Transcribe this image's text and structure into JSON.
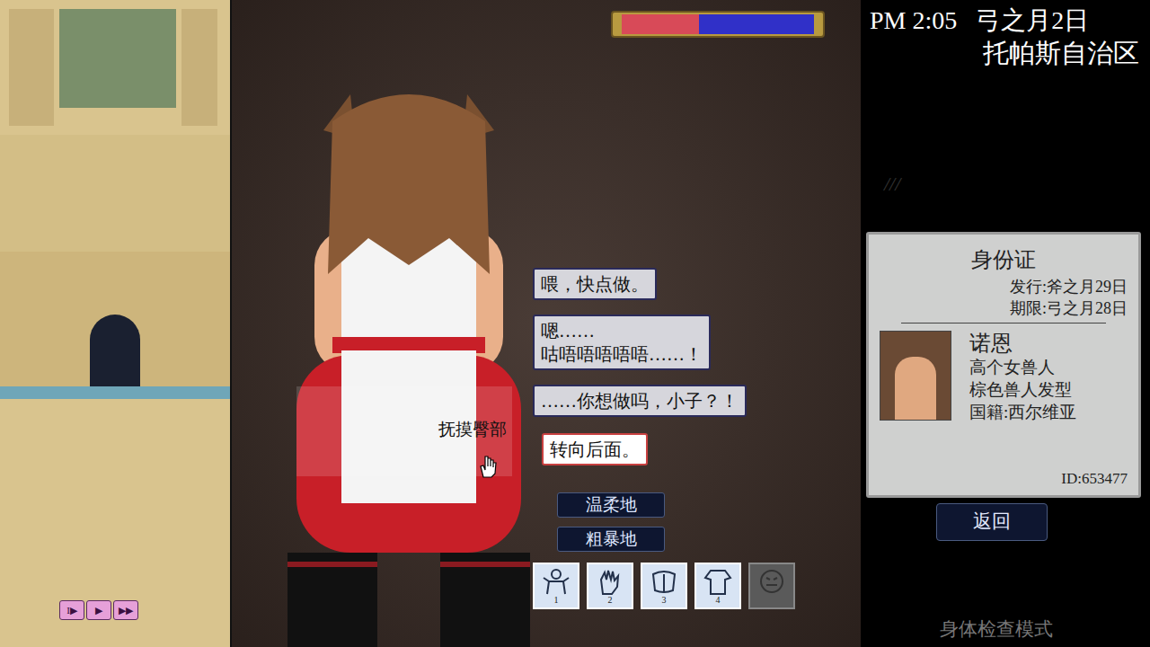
{
  "clock": {
    "time": "PM 2:05",
    "date": "弓之月2日",
    "location": "托帕斯自治区"
  },
  "scratch": "///",
  "gauge": {
    "level": 0.4
  },
  "dialog": [
    {
      "text": "喂，快点做。",
      "speaker": "npc"
    },
    {
      "text": "嗯……\n咕唔唔唔唔唔……！",
      "speaker": "npc"
    },
    {
      "text": "……你想做吗，小子？！",
      "speaker": "npc"
    },
    {
      "text": "转向后面。",
      "speaker": "player"
    }
  ],
  "hover_label": "抚摸臀部",
  "choices": [
    "温柔地",
    "粗暴地"
  ],
  "toolbar": [
    {
      "number": "1",
      "disabled": false
    },
    {
      "number": "2",
      "disabled": false
    },
    {
      "number": "3",
      "disabled": false
    },
    {
      "number": "4",
      "disabled": false
    },
    {
      "number": "",
      "disabled": true
    }
  ],
  "id_card": {
    "title": "身份证",
    "issued": "发行:斧之月29日",
    "expires": "期限:弓之月28日",
    "name": "诺恩",
    "lines": [
      "高个女兽人",
      "棕色兽人发型",
      "国籍:西尔维亚"
    ],
    "id": "ID:653477"
  },
  "back_button": "返回",
  "mode": "身体检查模式",
  "speed_controls": [
    {
      "symbol": "I▶"
    },
    {
      "symbol": "▶"
    },
    {
      "symbol": "▶▶"
    }
  ]
}
